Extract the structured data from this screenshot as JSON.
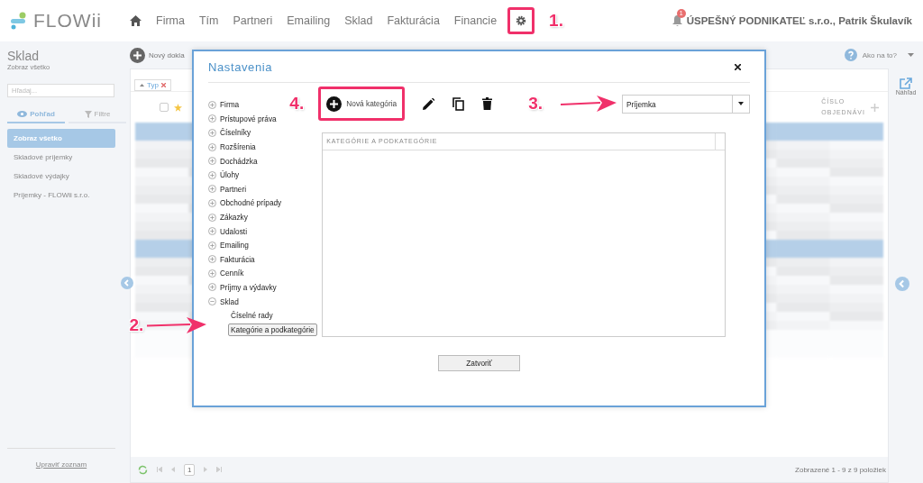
{
  "app": {
    "logo": "FLOWii"
  },
  "nav": {
    "items": [
      "Firma",
      "Tím",
      "Partneri",
      "Emailing",
      "Sklad",
      "Fakturácia",
      "Financie"
    ],
    "settings_annotation": "1."
  },
  "user": {
    "notifications": "1",
    "name": "ÚSPEŠNÝ PODNIKATEĽ s.r.o., Patrik Škulavík"
  },
  "sidebar": {
    "title": "Sklad",
    "subtitle": "Zobraz všetko",
    "search": {
      "placeholder": "Hľadaj..."
    },
    "tabs": [
      {
        "label": "Pohľad",
        "selected": true
      },
      {
        "label": "Filtre",
        "selected": false
      }
    ],
    "items": [
      {
        "label": "Zobraz všetko",
        "selected": true
      },
      {
        "label": "Skladové príjemky",
        "selected": false
      },
      {
        "label": "Skladové výdajky",
        "selected": false
      },
      {
        "label": "Príjemky - FLOWii s.r.o.",
        "selected": false
      }
    ],
    "footer_link": "Upraviť zoznam"
  },
  "toolbar": {
    "new_document": "Nový dokla",
    "help": "Ako na to?"
  },
  "table": {
    "filter_chip": "Typ",
    "select_all": {
      "checked": false
    },
    "column": [
      "ČÍSLO",
      "OBJEDNÁVI"
    ],
    "preview": "Náhľad",
    "page": "1",
    "status": "Zobrazené 1 - 9 z 9 položiek"
  },
  "dialog": {
    "title": "Nastavenia",
    "tree": [
      {
        "label": "Firma",
        "expanded": false
      },
      {
        "label": "Prístupové práva",
        "expanded": false
      },
      {
        "label": "Číselníky",
        "expanded": false
      },
      {
        "label": "Rozšírenia",
        "expanded": false
      },
      {
        "label": "Dochádzka",
        "expanded": false
      },
      {
        "label": "Úlohy",
        "expanded": false
      },
      {
        "label": "Partneri",
        "expanded": false
      },
      {
        "label": "Obchodné prípady",
        "expanded": false
      },
      {
        "label": "Zákazky",
        "expanded": false
      },
      {
        "label": "Udalosti",
        "expanded": false
      },
      {
        "label": "Emailing",
        "expanded": false
      },
      {
        "label": "Fakturácia",
        "expanded": false
      },
      {
        "label": "Cenník",
        "expanded": false
      },
      {
        "label": "Príjmy a výdavky",
        "expanded": false
      },
      {
        "label": "Sklad",
        "expanded": true,
        "children": [
          {
            "label": "Číselné rady",
            "selected": false
          },
          {
            "label": "Kategórie a podkategórie",
            "selected": true,
            "annotation": "2."
          }
        ]
      }
    ],
    "new_button": {
      "label": "Nová kategória",
      "annotation": "4."
    },
    "select": {
      "value": "Príjemka",
      "annotation": "3."
    },
    "table_header": "KATEGÓRIE A PODKATEGÓRIE",
    "close_button": "Zatvoriť"
  }
}
